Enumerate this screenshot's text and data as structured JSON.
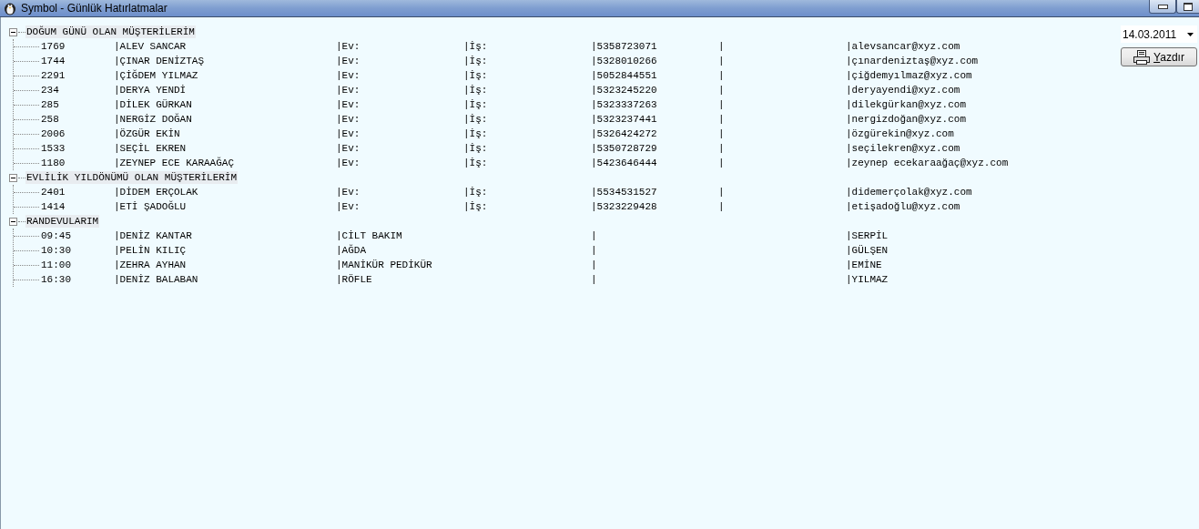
{
  "window": {
    "title": "Symbol - Günlük Hatırlatmalar"
  },
  "tree": [
    {
      "label": "DOĞUM GÜNÜ OLAN MÜŞTERİLERİM",
      "kind": "customers",
      "expanded": true,
      "children": [
        {
          "cells": [
            "1769",
            "|ALEV SANCAR",
            "|Ev:",
            "|İş:",
            "|5358723071",
            "|",
            "|alevsancar@xyz.com"
          ]
        },
        {
          "cells": [
            "1744",
            "|ÇINAR DENİZTAŞ",
            "|Ev:",
            "|İş:",
            "|5328010266",
            "|",
            "|çınardeniztaş@xyz.com"
          ]
        },
        {
          "cells": [
            "2291",
            "|ÇİĞDEM YILMAZ",
            "|Ev:",
            "|İş:",
            "|5052844551",
            "|",
            "|çiğdemyılmaz@xyz.com"
          ]
        },
        {
          "cells": [
            "234",
            "|DERYA YENDİ",
            "|Ev:",
            "|İş:",
            "|5323245220",
            "|",
            "|deryayendi@xyz.com"
          ]
        },
        {
          "cells": [
            "285",
            "|DİLEK GÜRKAN",
            "|Ev:",
            "|İş:",
            "|5323337263",
            "|",
            "|dilekgürkan@xyz.com"
          ]
        },
        {
          "cells": [
            "258",
            "|NERGİZ DOĞAN",
            "|Ev:",
            "|İş:",
            "|5323237441",
            "|",
            "|nergizdoğan@xyz.com"
          ]
        },
        {
          "cells": [
            "2006",
            "|ÖZGÜR EKİN",
            "|Ev:",
            "|İş:",
            "|5326424272",
            "|",
            "|özgürekin@xyz.com"
          ]
        },
        {
          "cells": [
            "1533",
            "|SEÇİL EKREN",
            "|Ev:",
            "|İş:",
            "|5350728729",
            "|",
            "|seçilekren@xyz.com"
          ]
        },
        {
          "cells": [
            "1180",
            "|ZEYNEP ECE KARAAĞAÇ",
            "|Ev:",
            "|İş:",
            "|5423646444",
            "|",
            "|zeynep ecekaraağaç@xyz.com"
          ]
        }
      ]
    },
    {
      "label": "EVLİLİK YILDÖNÜMÜ OLAN MÜŞTERİLERİM",
      "kind": "customers",
      "expanded": true,
      "children": [
        {
          "cells": [
            "2401",
            "|DİDEM ERÇOLAK",
            "|Ev:",
            "|İş:",
            "|5534531527",
            "|",
            "|didemerçolak@xyz.com"
          ]
        },
        {
          "cells": [
            "1414",
            "|ETİ ŞADOĞLU",
            "|Ev:",
            "|İş:",
            "|5323229428",
            "|",
            "|etişadoğlu@xyz.com"
          ]
        }
      ]
    },
    {
      "label": "RANDEVULARIM",
      "kind": "appointments",
      "expanded": true,
      "children": [
        {
          "cells": [
            "09:45",
            "|DENİZ KANTAR",
            "|CİLT BAKIM",
            "|",
            "|SERPİL"
          ]
        },
        {
          "cells": [
            "10:30",
            "|PELİN KILIÇ",
            "|AĞDA",
            "|",
            "|GÜLŞEN"
          ]
        },
        {
          "cells": [
            "11:00",
            "|ZEHRA AYHAN",
            "|MANİKÜR PEDİKÜR",
            "|",
            "|EMİNE"
          ]
        },
        {
          "cells": [
            "16:30",
            "|DENİZ BALABAN",
            "|RÖFLE",
            "|",
            "|YILMAZ"
          ]
        }
      ]
    }
  ],
  "date_picker": {
    "value": "14.03.2011"
  },
  "print_button": {
    "label": "Yazdır"
  }
}
